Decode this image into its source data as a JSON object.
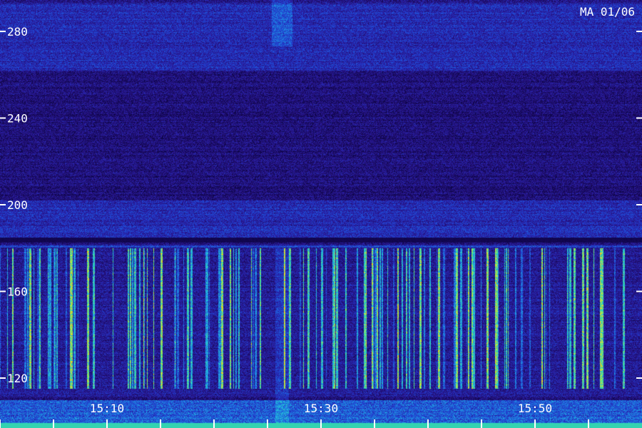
{
  "chart_data": {
    "type": "heatmap",
    "title": "",
    "xlabel": "",
    "ylabel": "",
    "corner_label": "MA 01/06",
    "y_ticks": [
      280,
      240,
      200,
      160,
      120
    ],
    "y_range": [
      112,
      293
    ],
    "x_tick_labels": [
      "15:10",
      "15:30",
      "15:50"
    ],
    "x_labeled_ticks_minutes_after_15": [
      10,
      30,
      50
    ],
    "x_minor_tick_minutes_after_15": [
      0,
      5,
      10,
      15,
      20,
      25,
      30,
      35,
      40,
      45,
      50,
      55
    ],
    "x_range_minutes_after_15": [
      -2.5,
      57.5
    ],
    "bands": [
      {
        "y_from": 262,
        "y_to": 293,
        "level": "moderate"
      },
      {
        "y_from": 202,
        "y_to": 262,
        "level": "low"
      },
      {
        "y_from": 183,
        "y_to": 202,
        "level": "moderate"
      },
      {
        "y_from": 112,
        "y_to": 180,
        "level": "bursty"
      }
    ],
    "colormap": [
      "#000033",
      "#1a0a5e",
      "#2a1a9a",
      "#2040d0",
      "#1f7fe0",
      "#20c0e0",
      "#40e090",
      "#c0f040",
      "#f0c020"
    ]
  }
}
